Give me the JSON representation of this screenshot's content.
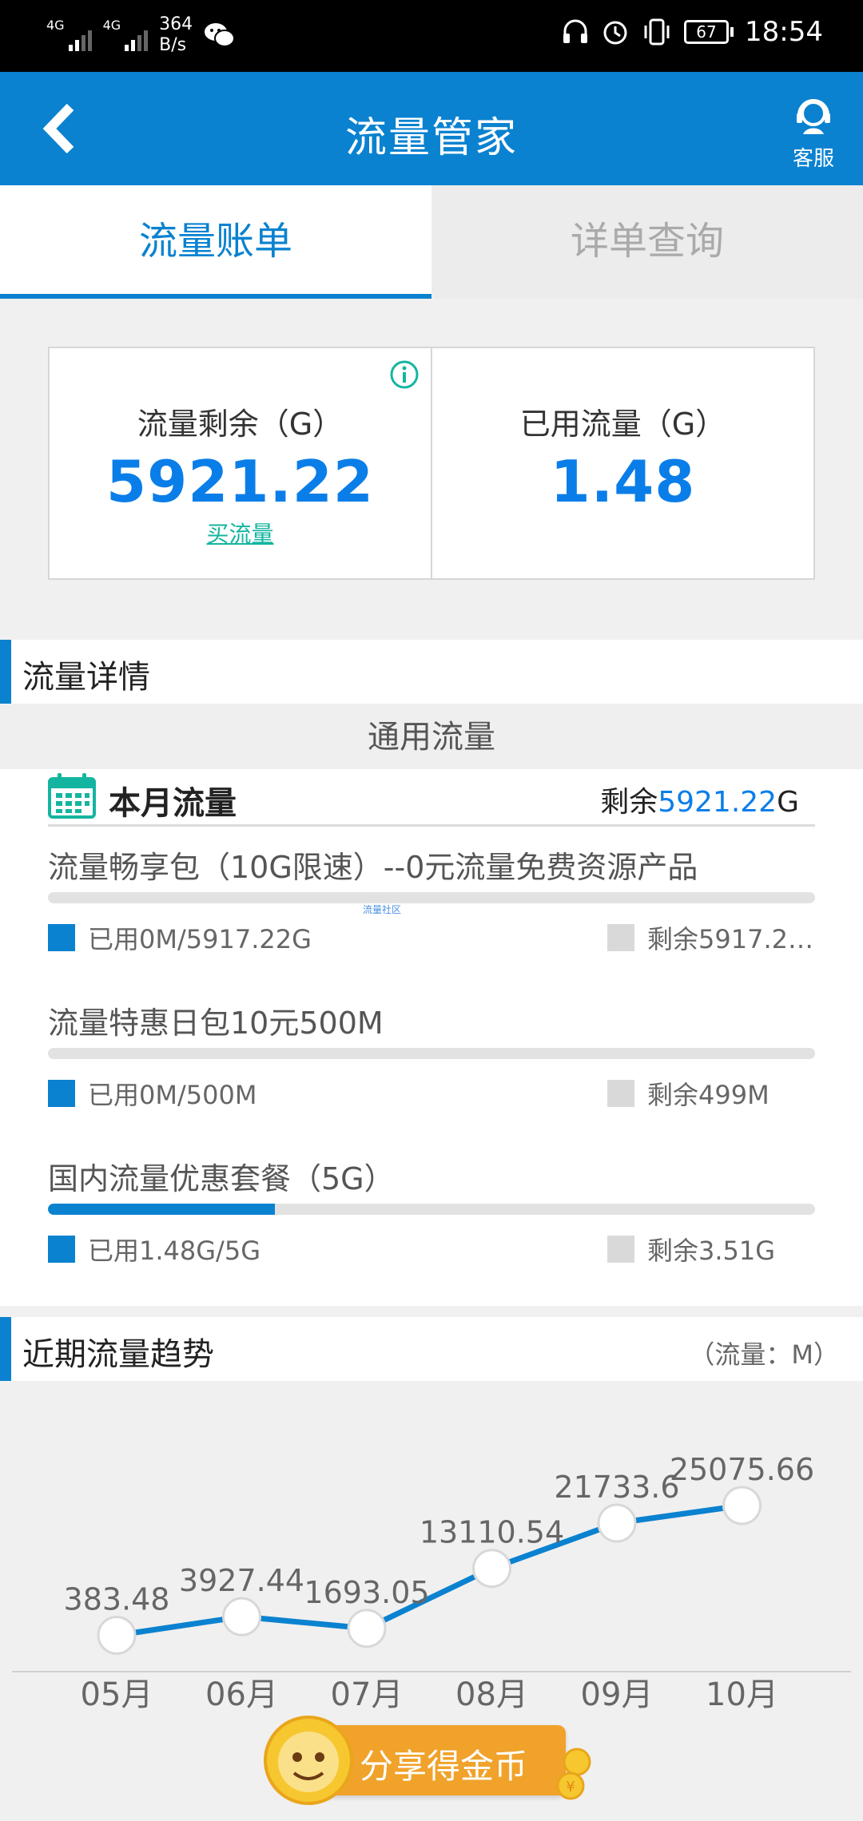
{
  "status_bar": {
    "signal1": "4G",
    "signal2": "4G",
    "speed_value": "364",
    "speed_unit": "B/s",
    "battery": "67",
    "time": "18:54"
  },
  "header": {
    "title": "流量管家",
    "service_label": "客服"
  },
  "tabs": [
    {
      "label": "流量账单",
      "active": true
    },
    {
      "label": "详单查询",
      "active": false
    }
  ],
  "summary": {
    "remaining_label": "流量剩余（G）",
    "remaining_value": "5921.22",
    "buy_link": "买流量",
    "used_label": "已用流量（G）",
    "used_value": "1.48"
  },
  "details": {
    "section_title": "流量详情",
    "subtype": "通用流量",
    "month_title": "本月流量",
    "month_remain_prefix": "剩余",
    "month_remain_value": "5921.22",
    "month_remain_unit": "G",
    "watermark": "流量社区",
    "packages": [
      {
        "name": "流量畅享包（10G限速）--0元流量免费资源产品",
        "used": "已用0M/5917.22G",
        "remain": "剩余5917.2…",
        "used_fraction": 0.0
      },
      {
        "name": "流量特惠日包10元500M",
        "used": "已用0M/500M",
        "remain": "剩余499M",
        "used_fraction": 0.0
      },
      {
        "name": "国内流量优惠套餐（5G）",
        "used": "已用1.48G/5G",
        "remain": "剩余3.51G",
        "used_fraction": 0.296
      }
    ]
  },
  "trend": {
    "section_title": "近期流量趋势",
    "unit": "（流量：M）"
  },
  "chart_data": {
    "type": "line",
    "categories": [
      "05月",
      "06月",
      "07月",
      "08月",
      "09月",
      "10月"
    ],
    "values": [
      383.48,
      3927.44,
      1693.05,
      13110.54,
      21733.6,
      25075.66
    ],
    "value_labels": [
      "383.48",
      "3927.44",
      "1693.05",
      "13110.54",
      "21733.6",
      "25075.66"
    ],
    "ylabel": "（流量：M）",
    "grid": false,
    "line_color": "#0a82d0"
  },
  "share": {
    "label": "分享得金币"
  },
  "colors": {
    "primary": "#0a82d0",
    "accent_number": "#0a7ee8",
    "link": "#14b5a0",
    "share_button": "#f0a22a"
  }
}
